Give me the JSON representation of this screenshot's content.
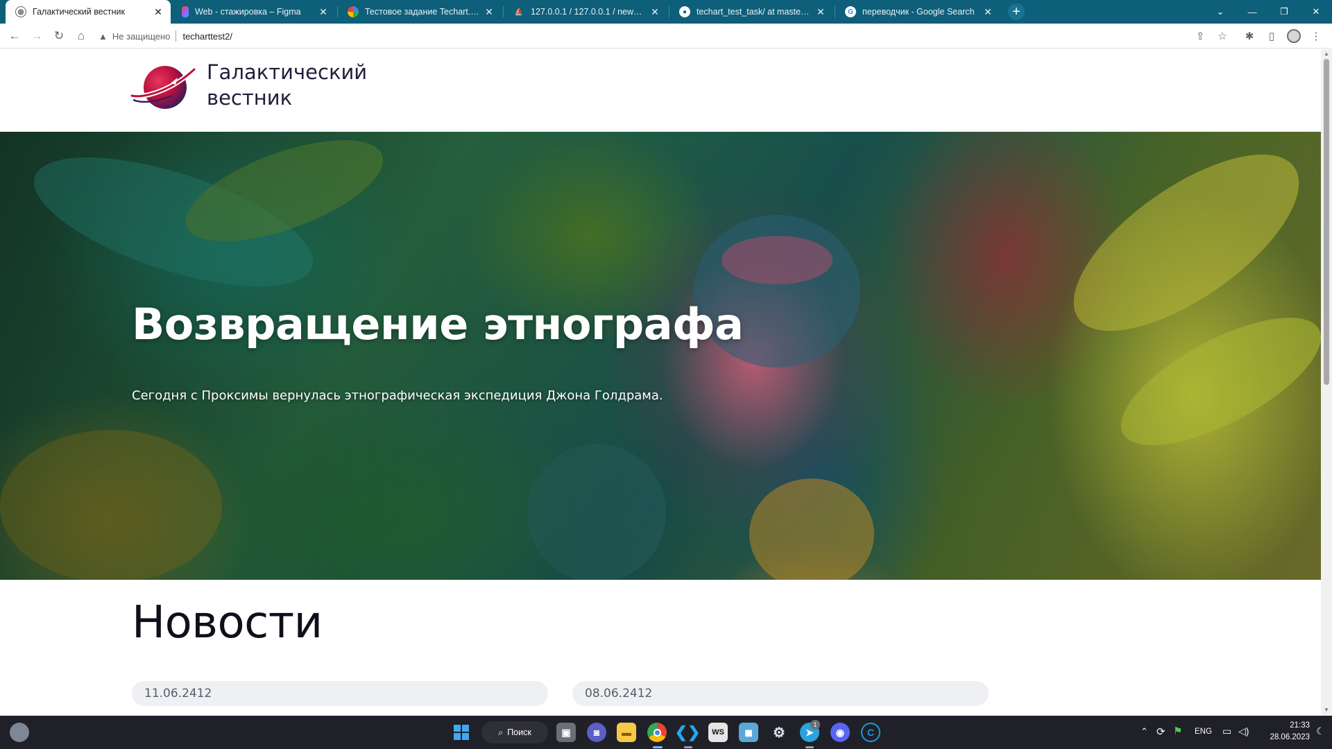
{
  "browser": {
    "tabs": [
      {
        "title": "Галактический вестник",
        "active": true,
        "icon": "globe-icon"
      },
      {
        "title": "Web - стажировка – Figma",
        "active": false,
        "icon": "figma-icon"
      },
      {
        "title": "Тестовое задание Techart.Web",
        "active": false,
        "icon": "google-docs-icon"
      },
      {
        "title": "127.0.0.1 / 127.0.0.1 / news / new",
        "active": false,
        "icon": "phpmyadmin-icon"
      },
      {
        "title": "techart_test_task/ at master · the",
        "active": false,
        "icon": "github-icon"
      },
      {
        "title": "переводчик - Google Search",
        "active": false,
        "icon": "google-icon"
      }
    ],
    "security_label": "Не защищено",
    "url": "techarttest2/"
  },
  "site": {
    "title": "Галактический вестник",
    "hero": {
      "title": "Возвращение этнографа",
      "subtitle": "Сегодня с Проксимы вернулась этнографическая экспедиция Джона Голдрама."
    },
    "news": {
      "heading": "Новости",
      "cards": [
        {
          "date": "11.06.2412"
        },
        {
          "date": "08.06.2412"
        }
      ]
    }
  },
  "taskbar": {
    "search_label": "Поиск",
    "language": "ENG",
    "time": "21:33",
    "date": "28.06.2023",
    "telegram_badge": "1"
  },
  "colors": {
    "tab_strip": "#0e5f7a",
    "brand_logo": "#c1123f",
    "news_card_bg": "#eef0f3"
  }
}
